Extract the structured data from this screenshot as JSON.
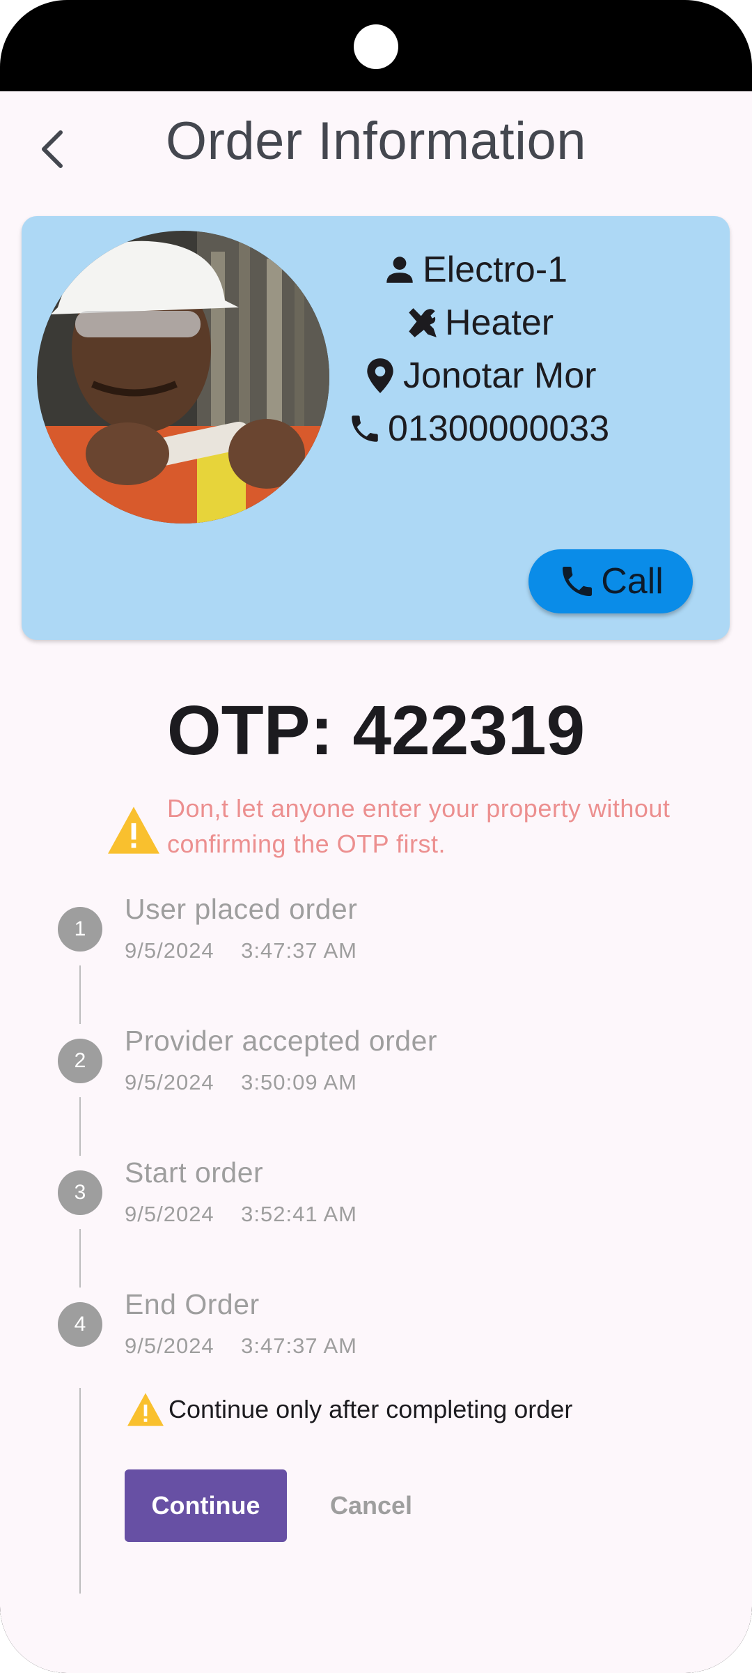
{
  "header": {
    "title": "Order Information"
  },
  "icons": {
    "back": "chevron-left-icon",
    "person": "person-icon",
    "tools": "tools-icon",
    "location": "location-pin-icon",
    "phone": "phone-icon",
    "warning": "warning-icon"
  },
  "provider": {
    "name": "Electro-1",
    "service": "Heater",
    "location": "Jonotar Mor",
    "phone": "01300000033",
    "call_label": "Call"
  },
  "otp": {
    "text": "OTP: 422319",
    "warning": "Don,t let anyone enter your property without confirming the OTP first."
  },
  "steps": [
    {
      "number": "1",
      "title": "User placed order",
      "date": "9/5/2024",
      "time": "3:47:37 AM"
    },
    {
      "number": "2",
      "title": "Provider accepted order",
      "date": "9/5/2024",
      "time": "3:50:09 AM"
    },
    {
      "number": "3",
      "title": "Start order",
      "date": "9/5/2024",
      "time": "3:52:41 AM"
    },
    {
      "number": "4",
      "title": "End Order",
      "date": "9/5/2024",
      "time": "3:47:37 AM"
    }
  ],
  "step4_note": "Continue only after completing order",
  "actions": {
    "continue_label": "Continue",
    "cancel_label": "Cancel"
  },
  "colors": {
    "card_bg": "#add8f5",
    "call_button": "#0a8ce8",
    "primary": "#6750a4",
    "warning_text": "#ec8f8f",
    "warning_icon": "#f9c02e",
    "step_inactive": "#9e9e9e"
  }
}
